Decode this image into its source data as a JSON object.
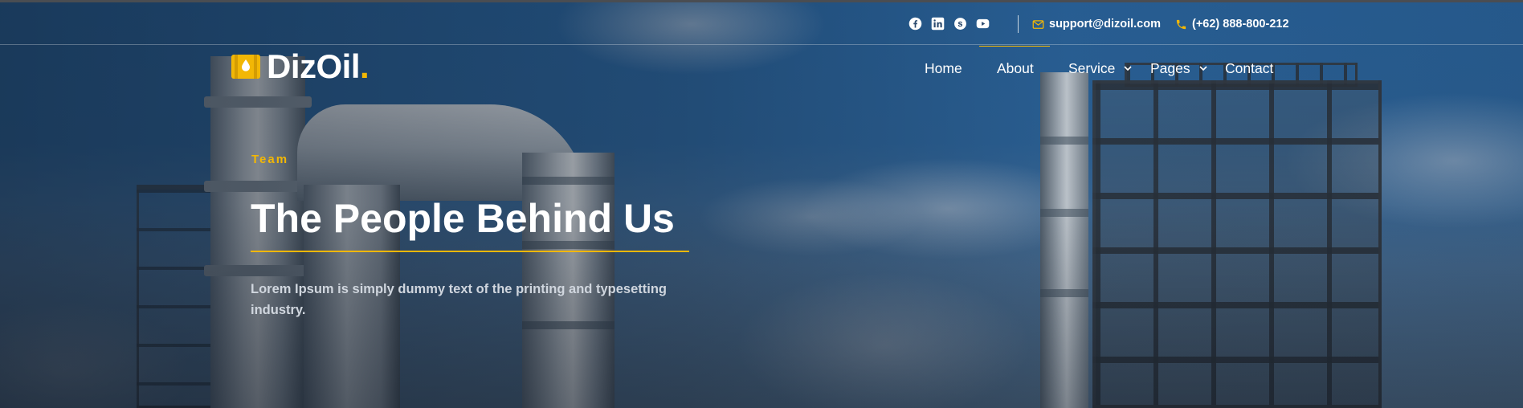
{
  "topbar": {
    "social_icons": [
      "facebook-icon",
      "linkedin-icon",
      "skype-icon",
      "youtube-icon"
    ],
    "email": "support@dizoil.com",
    "phone": "(+62) 888-800-212"
  },
  "brand": {
    "name": "DizOil",
    "dot": ".",
    "accent_color": "#f2b705"
  },
  "nav": {
    "items": [
      {
        "label": "Home"
      },
      {
        "label": "About"
      },
      {
        "label": "Service"
      },
      {
        "label": "Pages"
      },
      {
        "label": "Contact"
      }
    ]
  },
  "hero": {
    "eyebrow": "Team",
    "title": "The People Behind Us",
    "description": "Lorem Ipsum is simply dummy text of the printing and typesetting industry."
  }
}
